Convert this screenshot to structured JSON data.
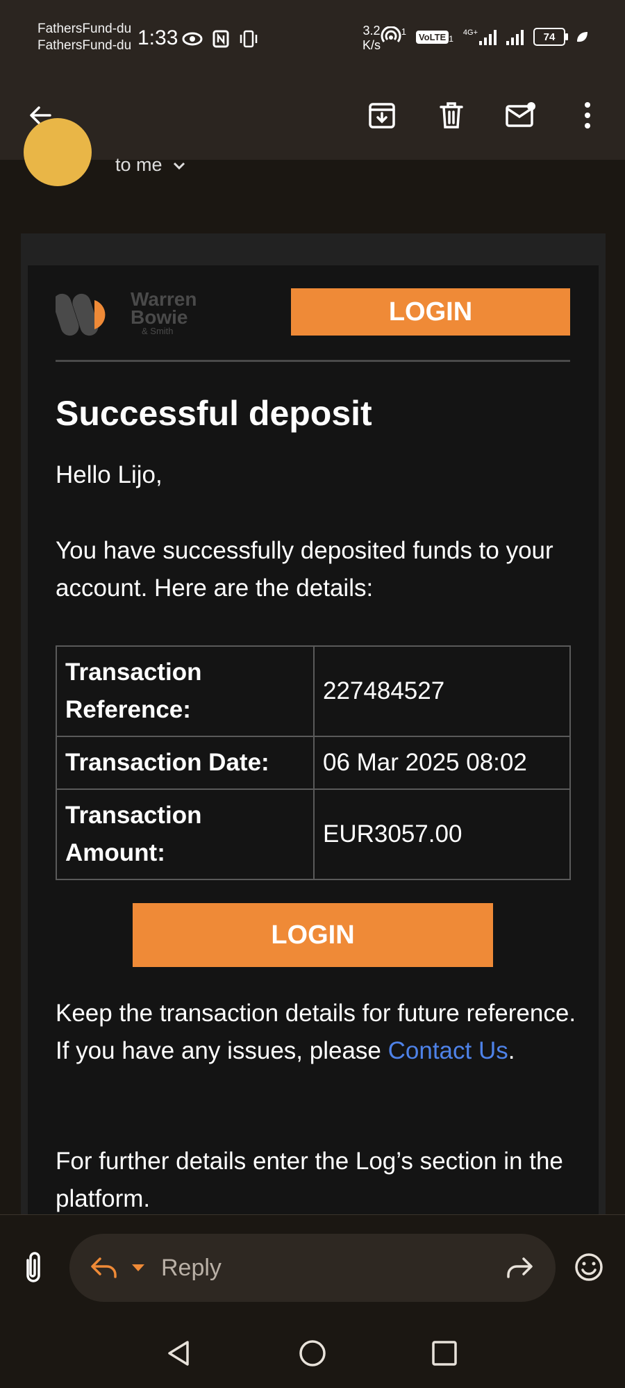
{
  "status_bar": {
    "notifications": [
      "FathersFund-du",
      "FathersFund-du"
    ],
    "time": "1:33",
    "net_speed": [
      "3.2",
      "K/s"
    ],
    "hotspot_sup": "1",
    "volte": "VoLTE",
    "volte_sub": "1",
    "net_type": "4G+",
    "battery": "74"
  },
  "app_bar": {
    "icons": [
      "back-arrow-icon",
      "archive-icon",
      "delete-icon",
      "mark-unread-icon",
      "more-vert-icon"
    ]
  },
  "sender": {
    "recipient": "to me"
  },
  "email": {
    "logo": {
      "line1": "Warren",
      "line2": "Bowie",
      "line3": "& Smith"
    },
    "login_top": "LOGIN",
    "heading": "Successful deposit",
    "greeting": "Hello Lijo,",
    "intro": "You have successfully deposited funds to your account. Here are the details:",
    "transaction": [
      {
        "label": "Transaction Reference:",
        "value": "227484527"
      },
      {
        "label": "Transaction Date:",
        "value": "06 Mar 2025 08:02"
      },
      {
        "label": "Transaction Amount:",
        "value": "EUR3057.00"
      }
    ],
    "login_mid": "LOGIN",
    "keep_text": "Keep the transaction details for future reference. If you have any issues, please ",
    "contact_link": "Contact Us",
    "keep_end": ".",
    "further": "For further details enter the Log’s section in the platform."
  },
  "reply_bar": {
    "reply_label": "Reply"
  },
  "colors": {
    "accent": "#ef8a37",
    "link": "#4e82e8",
    "app_bg": "#1b1712",
    "toolbar_bg": "#2b2520"
  }
}
